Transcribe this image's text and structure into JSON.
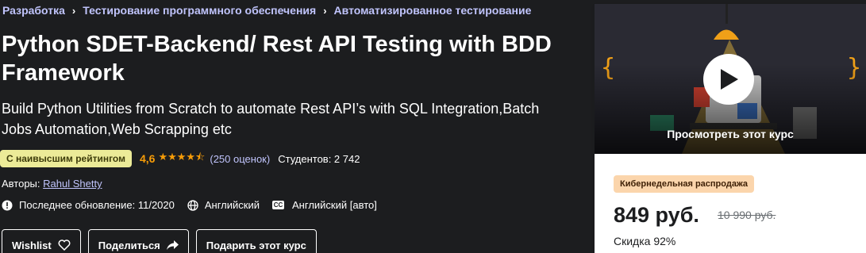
{
  "breadcrumb": [
    "Разработка",
    "Тестирование программного обеспечения",
    "Автоматизированное тестирование"
  ],
  "course": {
    "title": "Python SDET-Backend/ Rest API Testing with BDD Framework",
    "subtitle": "Build Python Utilities from Scratch to automate Rest API’s with SQL Integration,Batch Jobs Automation,Web Scrapping etc"
  },
  "rating": {
    "badge": "С наивысшим рейтингом",
    "value": "4,6",
    "stars": 4.5,
    "count": "(250 оценок)",
    "students": "Студентов: 2 742"
  },
  "authors": {
    "label": "Авторы: ",
    "name": "Rahul Shetty"
  },
  "meta": {
    "updated": "Последнее обновление: 11/2020",
    "language": "Английский",
    "captions": "Английский [авто]",
    "captions_icon_text": "CC"
  },
  "buttons": {
    "wishlist": "Wishlist",
    "share": "Поделиться",
    "gift": "Подарить этот курс"
  },
  "sidebar": {
    "preview_label": "Просмотреть этот курс",
    "sale_badge": "Кибернедельная распродажа",
    "price": "849 руб.",
    "old_price": "10 990 руб.",
    "discount": "Скидка 92%"
  },
  "colors": {
    "background": "#1c1d1f",
    "link": "#c0c4fc",
    "rating": "#f69c08",
    "bestseller_badge": "#eceb98",
    "sale_badge": "#fbd5ac"
  }
}
